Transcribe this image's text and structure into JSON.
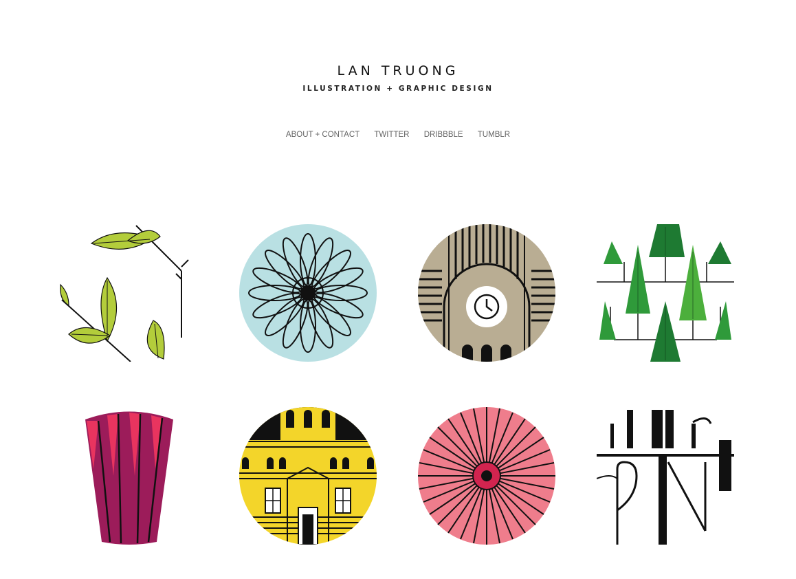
{
  "header": {
    "title": "LAN TRUONG",
    "tagline": "ILLUSTRATION + GRAPHIC DESIGN"
  },
  "nav": {
    "items": [
      {
        "label": "ABOUT + CONTACT"
      },
      {
        "label": "TWITTER"
      },
      {
        "label": "DRIBBBLE"
      },
      {
        "label": "TUMBLR"
      }
    ]
  },
  "portfolio": {
    "tiles": [
      {
        "icon": "leaves-branch-icon"
      },
      {
        "icon": "blue-flower-icon"
      },
      {
        "icon": "clock-tower-icon"
      },
      {
        "icon": "pine-trees-icon"
      },
      {
        "icon": "pink-petal-icon"
      },
      {
        "icon": "yellow-building-icon"
      },
      {
        "icon": "pink-umbrella-icon"
      },
      {
        "icon": "typographic-lettering-icon"
      }
    ]
  },
  "colors": {
    "leaf": "#b3cd3b",
    "flower": "#b9e0e3",
    "tower": "#b9ad93",
    "tree_dark": "#1e7a32",
    "tree_mid": "#2f9a3a",
    "tree_light": "#4caf3c",
    "petal": "#9c1c5a",
    "building": "#f3d52a",
    "umbrella": "#ef7d8c"
  }
}
